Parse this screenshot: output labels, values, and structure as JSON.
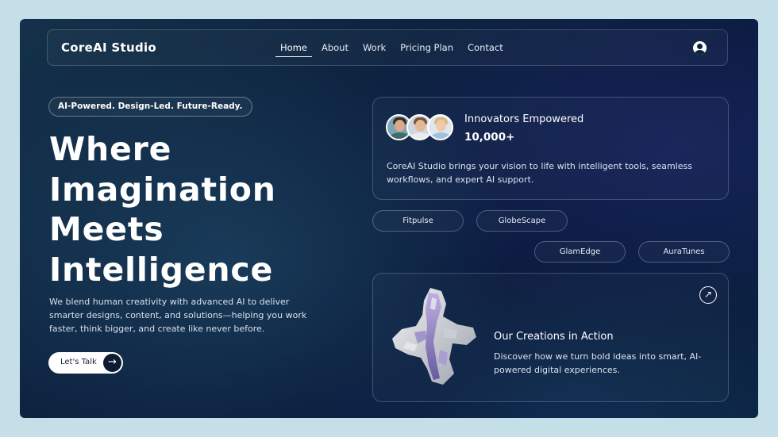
{
  "brand": {
    "name": "CoreAI Studio"
  },
  "nav": {
    "items": [
      {
        "label": "Home",
        "active": true
      },
      {
        "label": "About"
      },
      {
        "label": "Work"
      },
      {
        "label": "Pricing Plan"
      },
      {
        "label": "Contact"
      }
    ],
    "user_icon": "user-circle-icon"
  },
  "hero": {
    "tagline": "AI-Powered. Design-Led. Future-Ready.",
    "headline": [
      "Where",
      "Imagination",
      "Meets",
      "Intelligence"
    ],
    "lead": "We blend human creativity with advanced AI to deliver smarter designs, content, and solutions—helping you work faster, think bigger, and create like never before.",
    "cta_label": "Let's Talk",
    "cta_icon": "arrow-right-icon"
  },
  "stats_card": {
    "title": "Innovators Empowered",
    "count": "10,000+",
    "description": "CoreAI Studio brings your vision to life with intelligent tools, seamless workflows, and expert AI support."
  },
  "pills": [
    "Fitpulse",
    "GlobeScape",
    "GlamEdge",
    "AuraTunes"
  ],
  "showcase_card": {
    "title": "Our Creations in Action",
    "description": "Discover how we turn bold ideas into smart, AI-powered digital experiences.",
    "link_icon": "arrow-up-right-icon"
  },
  "colors": {
    "page_bg": "#c5dfe9",
    "panel_bg": "#0d2340",
    "text": "#ffffff",
    "muted_text": "#d7e0ec"
  }
}
